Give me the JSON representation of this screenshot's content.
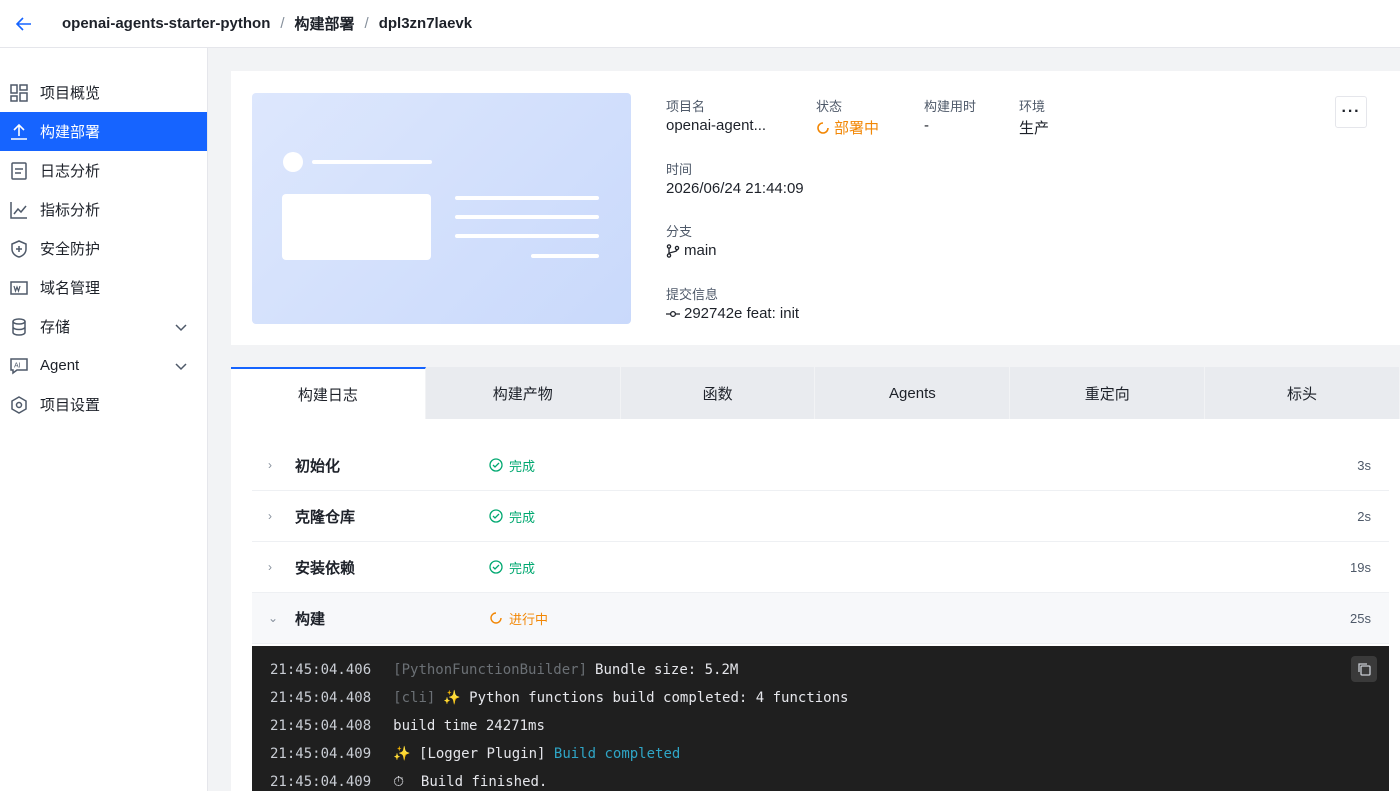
{
  "header": {
    "back_icon": "arrow-left-icon",
    "breadcrumbs": [
      "openai-agents-starter-python",
      "构建部署",
      "dpl3zn7laevk"
    ],
    "separator": "/"
  },
  "sidebar": {
    "items": [
      {
        "label": "项目概览",
        "icon": "dashboard-icon"
      },
      {
        "label": "构建部署",
        "icon": "upload-icon",
        "active": true
      },
      {
        "label": "日志分析",
        "icon": "document-icon"
      },
      {
        "label": "指标分析",
        "icon": "line-chart-icon"
      },
      {
        "label": "安全防护",
        "icon": "shield-icon"
      },
      {
        "label": "域名管理",
        "icon": "domain-icon"
      },
      {
        "label": "存储",
        "icon": "database-icon",
        "expandable": true
      },
      {
        "label": "Agent",
        "icon": "ai-icon",
        "expandable": true
      },
      {
        "label": "项目设置",
        "icon": "settings-icon"
      }
    ]
  },
  "deployment": {
    "project_label": "项目名",
    "project_value": "openai-agent...",
    "status_label": "状态",
    "status_value": "部署中",
    "build_time_label": "构建用时",
    "build_time_value": "-",
    "env_label": "环境",
    "env_value": "生产",
    "time_label": "时间",
    "time_value": "2026/06/24 21:44:09",
    "branch_label": "分支",
    "branch_value": "main",
    "commit_label": "提交信息",
    "commit_value": "292742e feat: init",
    "more_label": "···"
  },
  "tabs": [
    "构建日志",
    "构建产物",
    "函数",
    "Agents",
    "重定向",
    "标头"
  ],
  "steps": [
    {
      "name": "初始化",
      "status": "完成",
      "state": "done",
      "duration": "3s"
    },
    {
      "name": "克隆仓库",
      "status": "完成",
      "state": "done",
      "duration": "2s"
    },
    {
      "name": "安装依赖",
      "status": "完成",
      "state": "done",
      "duration": "19s"
    },
    {
      "name": "构建",
      "status": "进行中",
      "state": "running",
      "duration": "25s"
    }
  ],
  "log": [
    {
      "ts": "21:45:04.406",
      "tag": "[PythonFunctionBuilder]",
      "text": "Bundle size: 5.2M",
      "hl": ""
    },
    {
      "ts": "21:45:04.408",
      "tag": "[cli]",
      "text": "✨ Python functions build completed: 4 functions",
      "hl": ""
    },
    {
      "ts": "21:45:04.408",
      "tag": "",
      "text": "build time 24271ms",
      "hl": ""
    },
    {
      "ts": "21:45:04.409",
      "tag": "",
      "text": "✨ [Logger Plugin] ",
      "hl": "Build completed"
    },
    {
      "ts": "21:45:04.409",
      "tag": "",
      "text": "⏱  Build finished.",
      "hl": ""
    }
  ],
  "colors": {
    "accent": "#1664ff",
    "success": "#00a870",
    "warning": "#f28705",
    "log_bg": "#1f1f1f"
  }
}
